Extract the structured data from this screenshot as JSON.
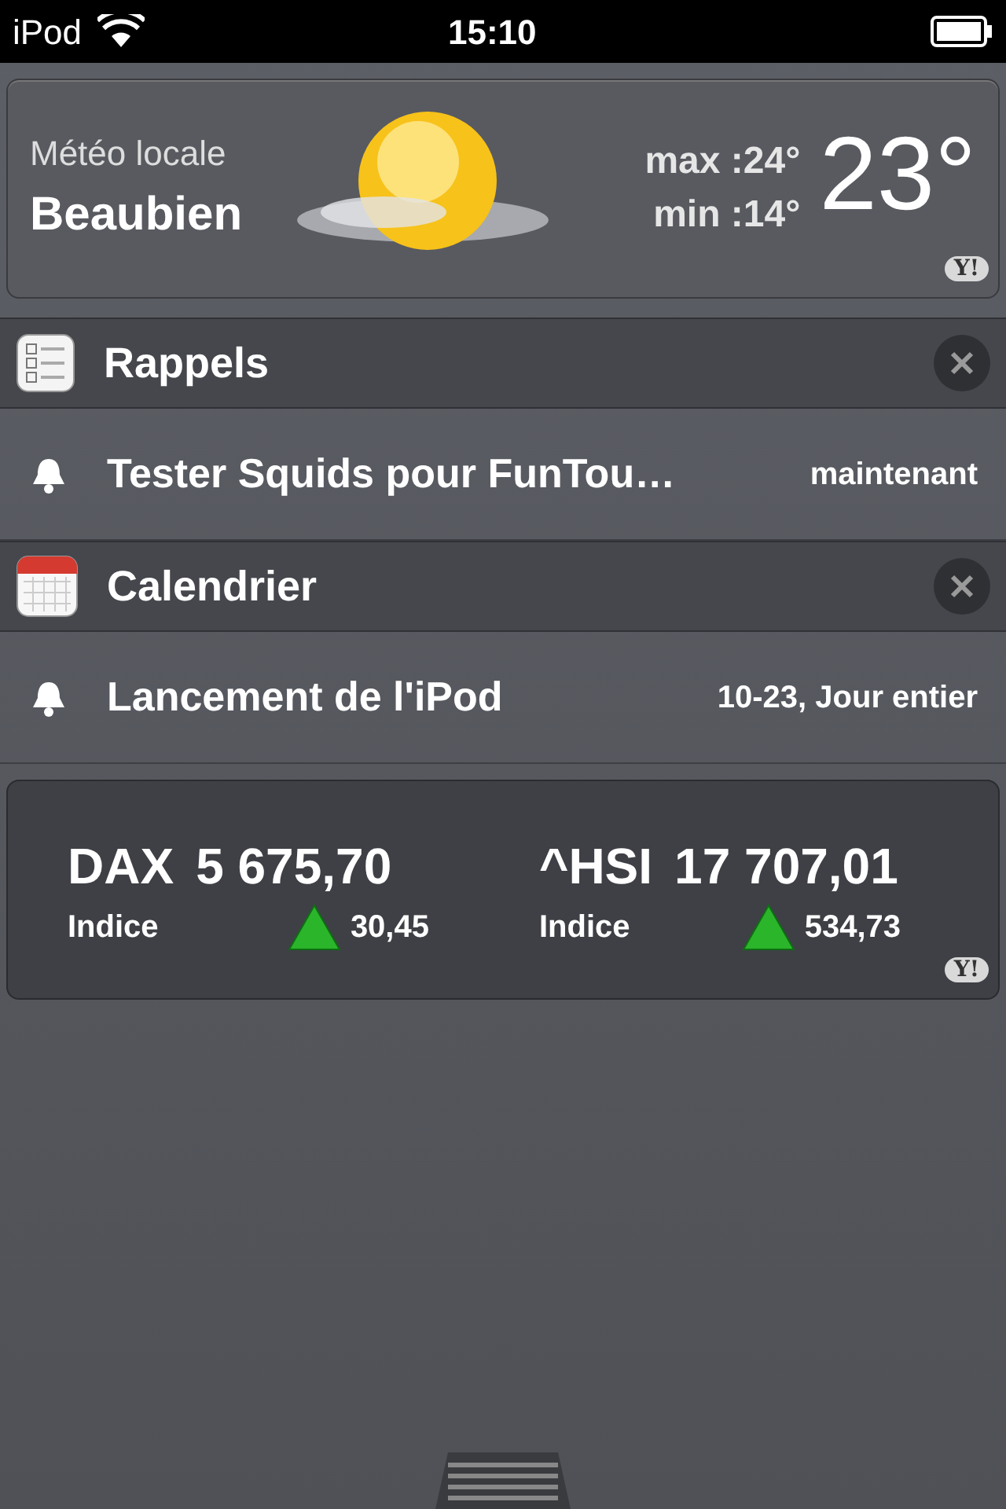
{
  "status_bar": {
    "carrier": "iPod",
    "time": "15:10"
  },
  "weather": {
    "label": "Météo locale",
    "city": "Beaubien",
    "max": "max :24°",
    "min": "min :14°",
    "temperature": "23°",
    "badge": "Y!"
  },
  "sections": [
    {
      "kind": "reminders",
      "title": "Rappels",
      "items": [
        {
          "text": "Tester Squids pour FunTou…",
          "time": "maintenant"
        }
      ]
    },
    {
      "kind": "calendar",
      "title": "Calendrier",
      "items": [
        {
          "text": "Lancement de l'iPod",
          "time": "10-23, Jour entier"
        }
      ]
    }
  ],
  "stocks": {
    "badge": "Y!",
    "quotes": [
      {
        "symbol": "DAX",
        "value": "5 675,70",
        "label": "Indice",
        "change": "30,45",
        "rising": true
      },
      {
        "symbol": "^HSI",
        "value": "17 707,01",
        "label": "Indice",
        "change": "534,73",
        "rising": true
      }
    ]
  }
}
